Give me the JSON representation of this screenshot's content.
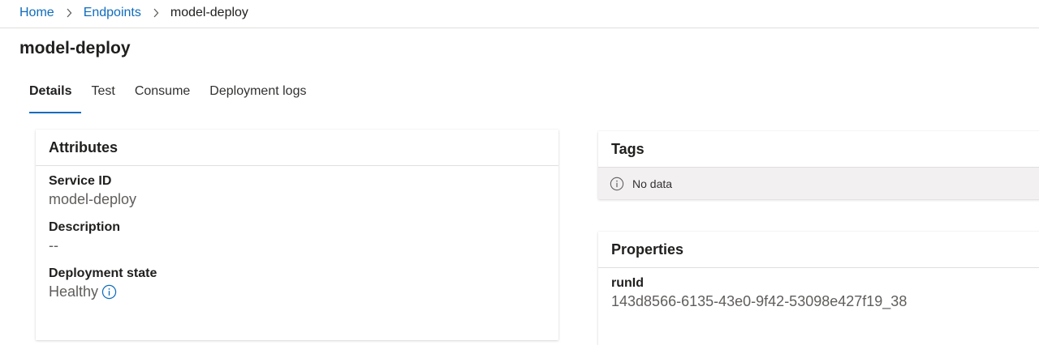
{
  "breadcrumb": {
    "home": "Home",
    "endpoints": "Endpoints",
    "current": "model-deploy"
  },
  "page": {
    "title": "model-deploy"
  },
  "tabs": [
    {
      "label": "Details",
      "active": true
    },
    {
      "label": "Test",
      "active": false
    },
    {
      "label": "Consume",
      "active": false
    },
    {
      "label": "Deployment logs",
      "active": false
    }
  ],
  "attributes": {
    "title": "Attributes",
    "service_id_label": "Service ID",
    "service_id_value": "model-deploy",
    "description_label": "Description",
    "description_value": "--",
    "deployment_state_label": "Deployment state",
    "deployment_state_value": "Healthy"
  },
  "tags": {
    "title": "Tags",
    "empty_text": "No data"
  },
  "properties": {
    "title": "Properties",
    "runid_label": "runId",
    "runid_value": "143d8566-6135-43e0-9f42-53098e427f19_38"
  },
  "colors": {
    "link": "#0f6cbd",
    "tab_indicator": "#0f6cbd",
    "info_icon": "#0f6cbd",
    "empty_banner": "#f3f0f2"
  },
  "icons": {
    "breadcrumb_separator": "chevron-right-icon",
    "state_info": "info-icon",
    "empty_info": "info-outline-icon"
  }
}
